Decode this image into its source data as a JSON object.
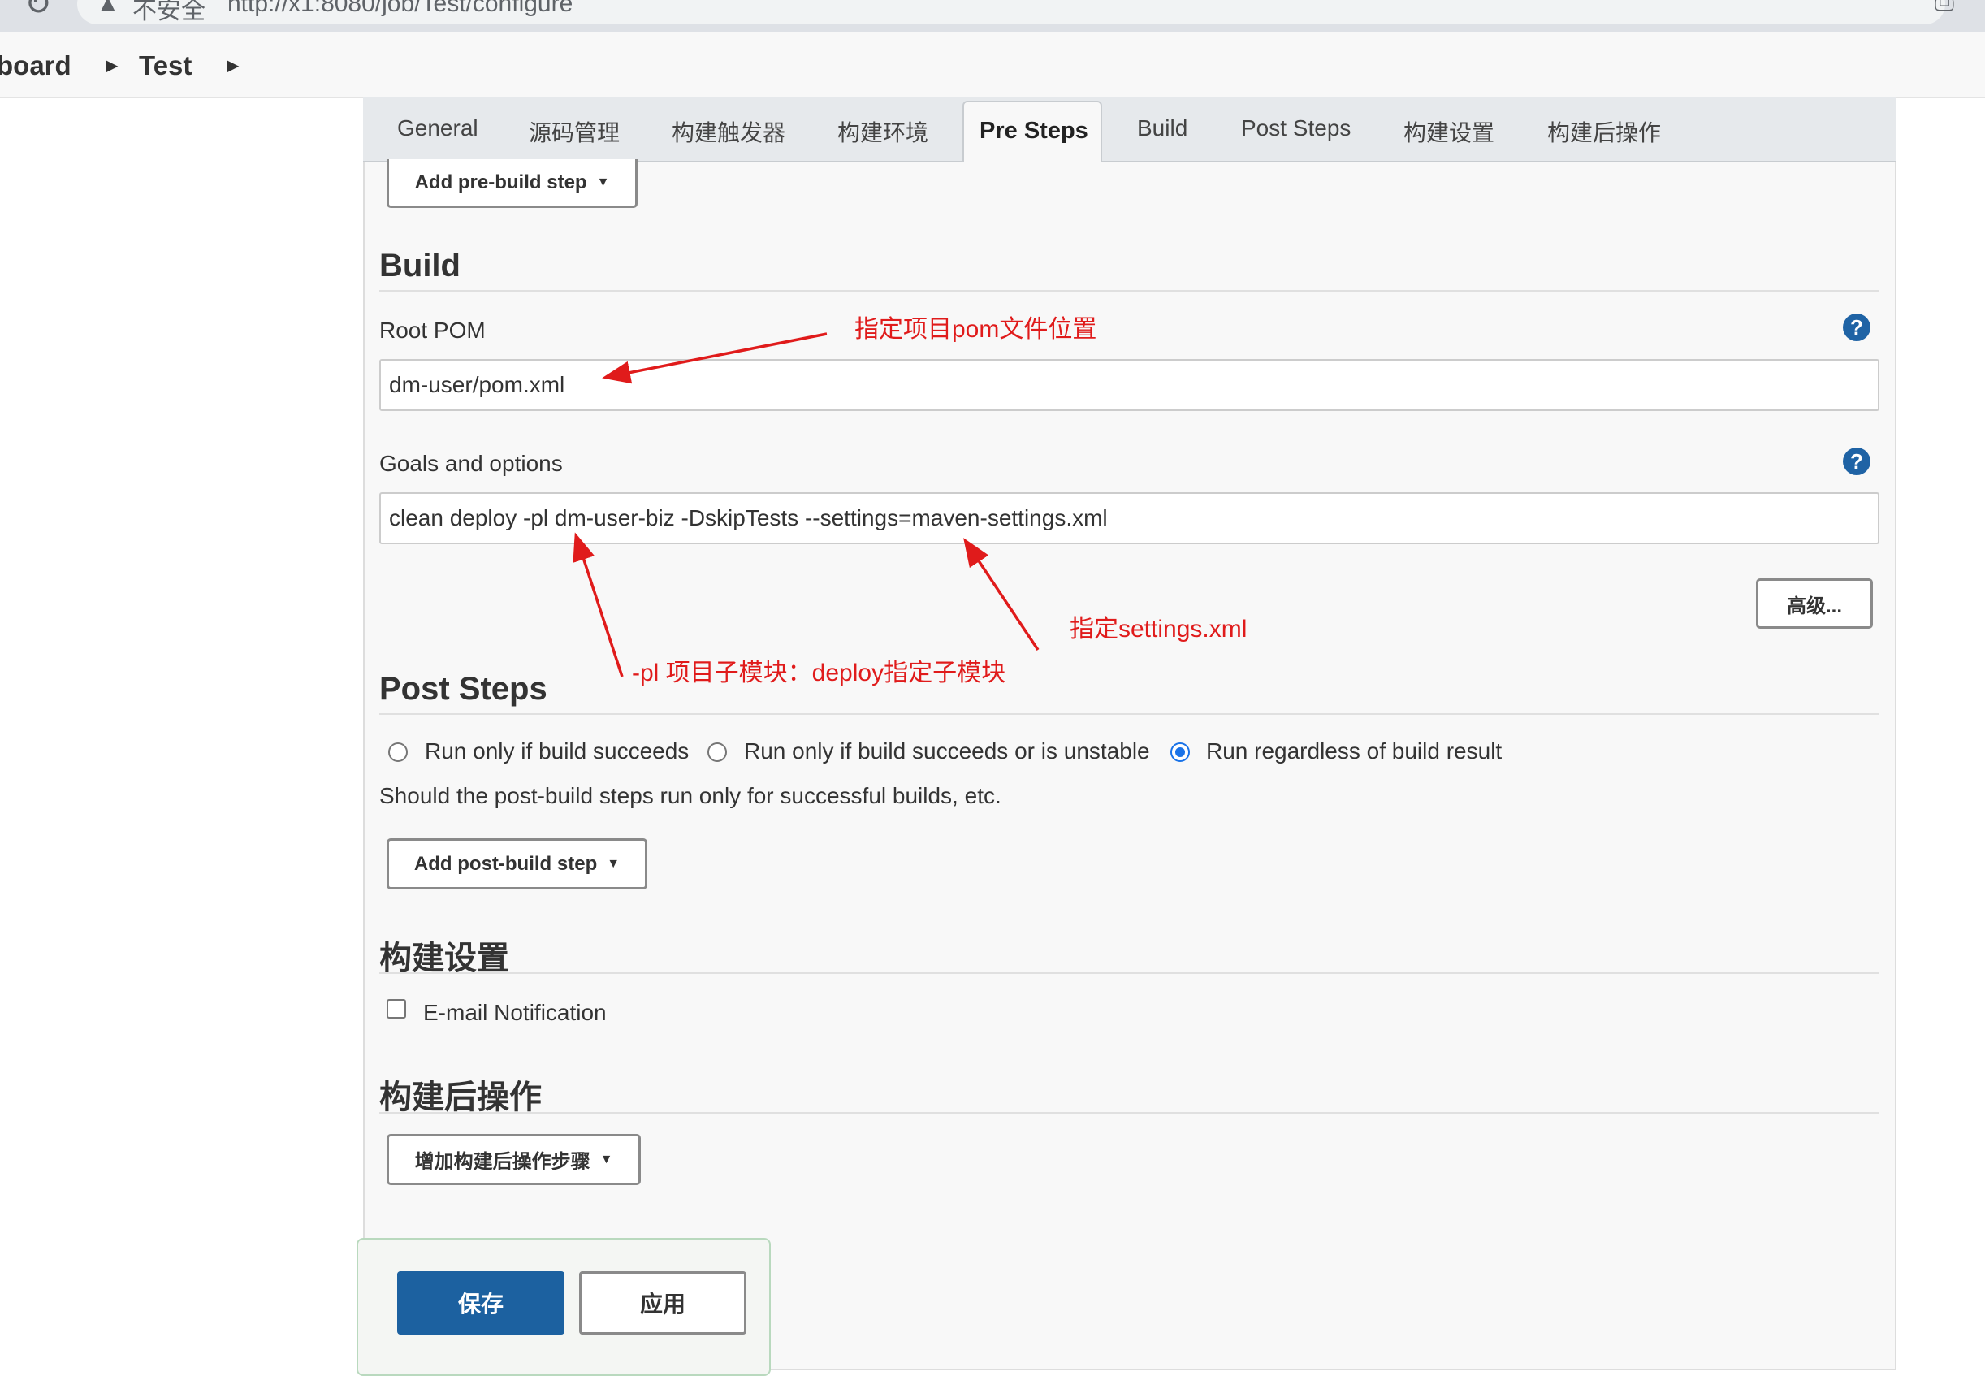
{
  "browser": {
    "security_label": "不安全",
    "url": "http://x1:8080/job/Test/configure"
  },
  "breadcrumb": {
    "items": [
      "board",
      "Test"
    ]
  },
  "tabs": [
    {
      "label": "General"
    },
    {
      "label": "源码管理"
    },
    {
      "label": "构建触发器"
    },
    {
      "label": "构建环境"
    },
    {
      "label": "Pre Steps"
    },
    {
      "label": "Build"
    },
    {
      "label": "Post Steps"
    },
    {
      "label": "构建设置"
    },
    {
      "label": "构建后操作"
    }
  ],
  "active_tab": "Pre Steps",
  "pre_steps": {
    "add_button": "Add pre-build step"
  },
  "build": {
    "title": "Build",
    "root_pom_label": "Root POM",
    "root_pom_value": "dm-user/pom.xml",
    "goals_label": "Goals and options",
    "goals_value": "clean deploy -pl dm-user-biz -DskipTests --settings=maven-settings.xml",
    "advanced_button": "高级..."
  },
  "post_steps": {
    "title": "Post Steps",
    "options": [
      {
        "label": "Run only if build succeeds",
        "selected": false
      },
      {
        "label": "Run only if build succeeds or is unstable",
        "selected": false
      },
      {
        "label": "Run regardless of build result",
        "selected": true
      }
    ],
    "description": "Should the post-build steps run only for successful builds, etc.",
    "add_button": "Add post-build step"
  },
  "build_settings": {
    "title": "构建设置",
    "email_label": "E-mail Notification",
    "email_checked": false
  },
  "post_build": {
    "title": "构建后操作",
    "add_button": "增加构建后操作步骤"
  },
  "actions": {
    "save": "保存",
    "apply": "应用"
  },
  "annotations": {
    "pom": "指定项目pom文件位置",
    "settings": "指定settings.xml",
    "module": "-pl 项目子模块：deploy指定子模块"
  },
  "colors": {
    "accent": "#1c61a0",
    "annotation": "#e01b1b",
    "radio_selected": "#1a73e8"
  }
}
